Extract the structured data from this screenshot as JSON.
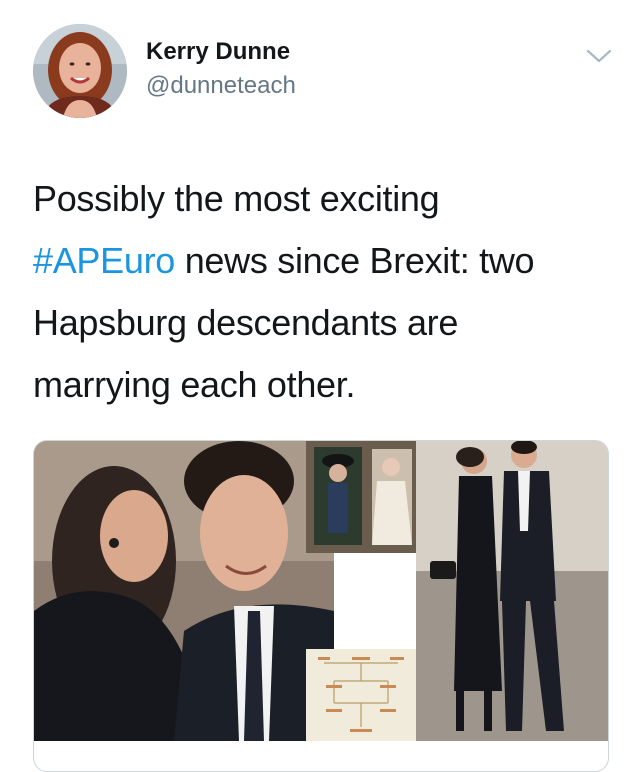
{
  "tweet": {
    "author": {
      "display_name": "Kerry Dunne",
      "handle": "@dunneteach",
      "avatar_icon": "user-avatar"
    },
    "menu_icon": "chevron-down-icon",
    "text": {
      "line1": "Possibly the most exciting",
      "hashtag": "#APEuro",
      "line2_rest": " news since Brexit: two",
      "line3": "Hapsburg descendants are",
      "line4": "marrying each other."
    },
    "link_card": {
      "image_icon": "news-photo-collage"
    },
    "colors": {
      "text": "#14171a",
      "secondary": "#657786",
      "link": "#1b95e0",
      "border": "#ccd6dd"
    }
  }
}
